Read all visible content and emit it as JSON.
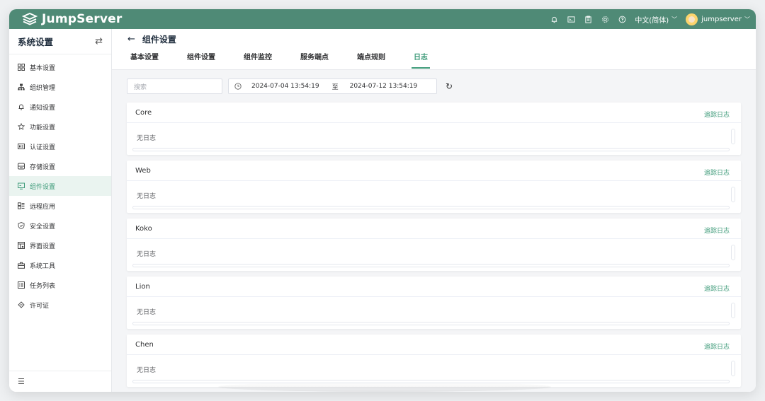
{
  "app": {
    "logo_text": "JumpServer",
    "accent": "#3f9b7a",
    "topbar_color": "#4f8a76"
  },
  "topbar": {
    "icons": [
      "bell-icon",
      "terminal-icon",
      "clipboard-icon",
      "gear-icon",
      "help-icon"
    ],
    "language": "中文(简体)",
    "username": "jumpserver"
  },
  "sidebar": {
    "title": "系统设置",
    "items": [
      {
        "label": "基本设置",
        "icon": "grid-icon"
      },
      {
        "label": "组织管理",
        "icon": "org-icon"
      },
      {
        "label": "通知设置",
        "icon": "bell-icon"
      },
      {
        "label": "功能设置",
        "icon": "star-icon"
      },
      {
        "label": "认证设置",
        "icon": "id-card-icon"
      },
      {
        "label": "存储设置",
        "icon": "storage-icon"
      },
      {
        "label": "组件设置",
        "icon": "monitor-icon",
        "active": true
      },
      {
        "label": "远程应用",
        "icon": "apps-icon"
      },
      {
        "label": "安全设置",
        "icon": "shield-icon"
      },
      {
        "label": "界面设置",
        "icon": "layout-icon"
      },
      {
        "label": "系统工具",
        "icon": "toolbox-icon"
      },
      {
        "label": "任务列表",
        "icon": "list-icon"
      },
      {
        "label": "许可证",
        "icon": "license-icon"
      }
    ]
  },
  "page": {
    "title": "组件设置",
    "tabs": [
      "基本设置",
      "组件设置",
      "组件监控",
      "服务端点",
      "端点规则",
      "日志"
    ],
    "active_tab": 5
  },
  "filters": {
    "search_placeholder": "搜索",
    "start": "2024-07-04 13:54:19",
    "separator": "至",
    "end": "2024-07-12 13:54:19"
  },
  "cards": [
    {
      "title": "Core",
      "link": "追踪日志",
      "body": "无日志"
    },
    {
      "title": "Web",
      "link": "追踪日志",
      "body": "无日志"
    },
    {
      "title": "Koko",
      "link": "追踪日志",
      "body": "无日志"
    },
    {
      "title": "Lion",
      "link": "追踪日志",
      "body": "无日志"
    },
    {
      "title": "Chen",
      "link": "追踪日志",
      "body": "无日志"
    }
  ]
}
